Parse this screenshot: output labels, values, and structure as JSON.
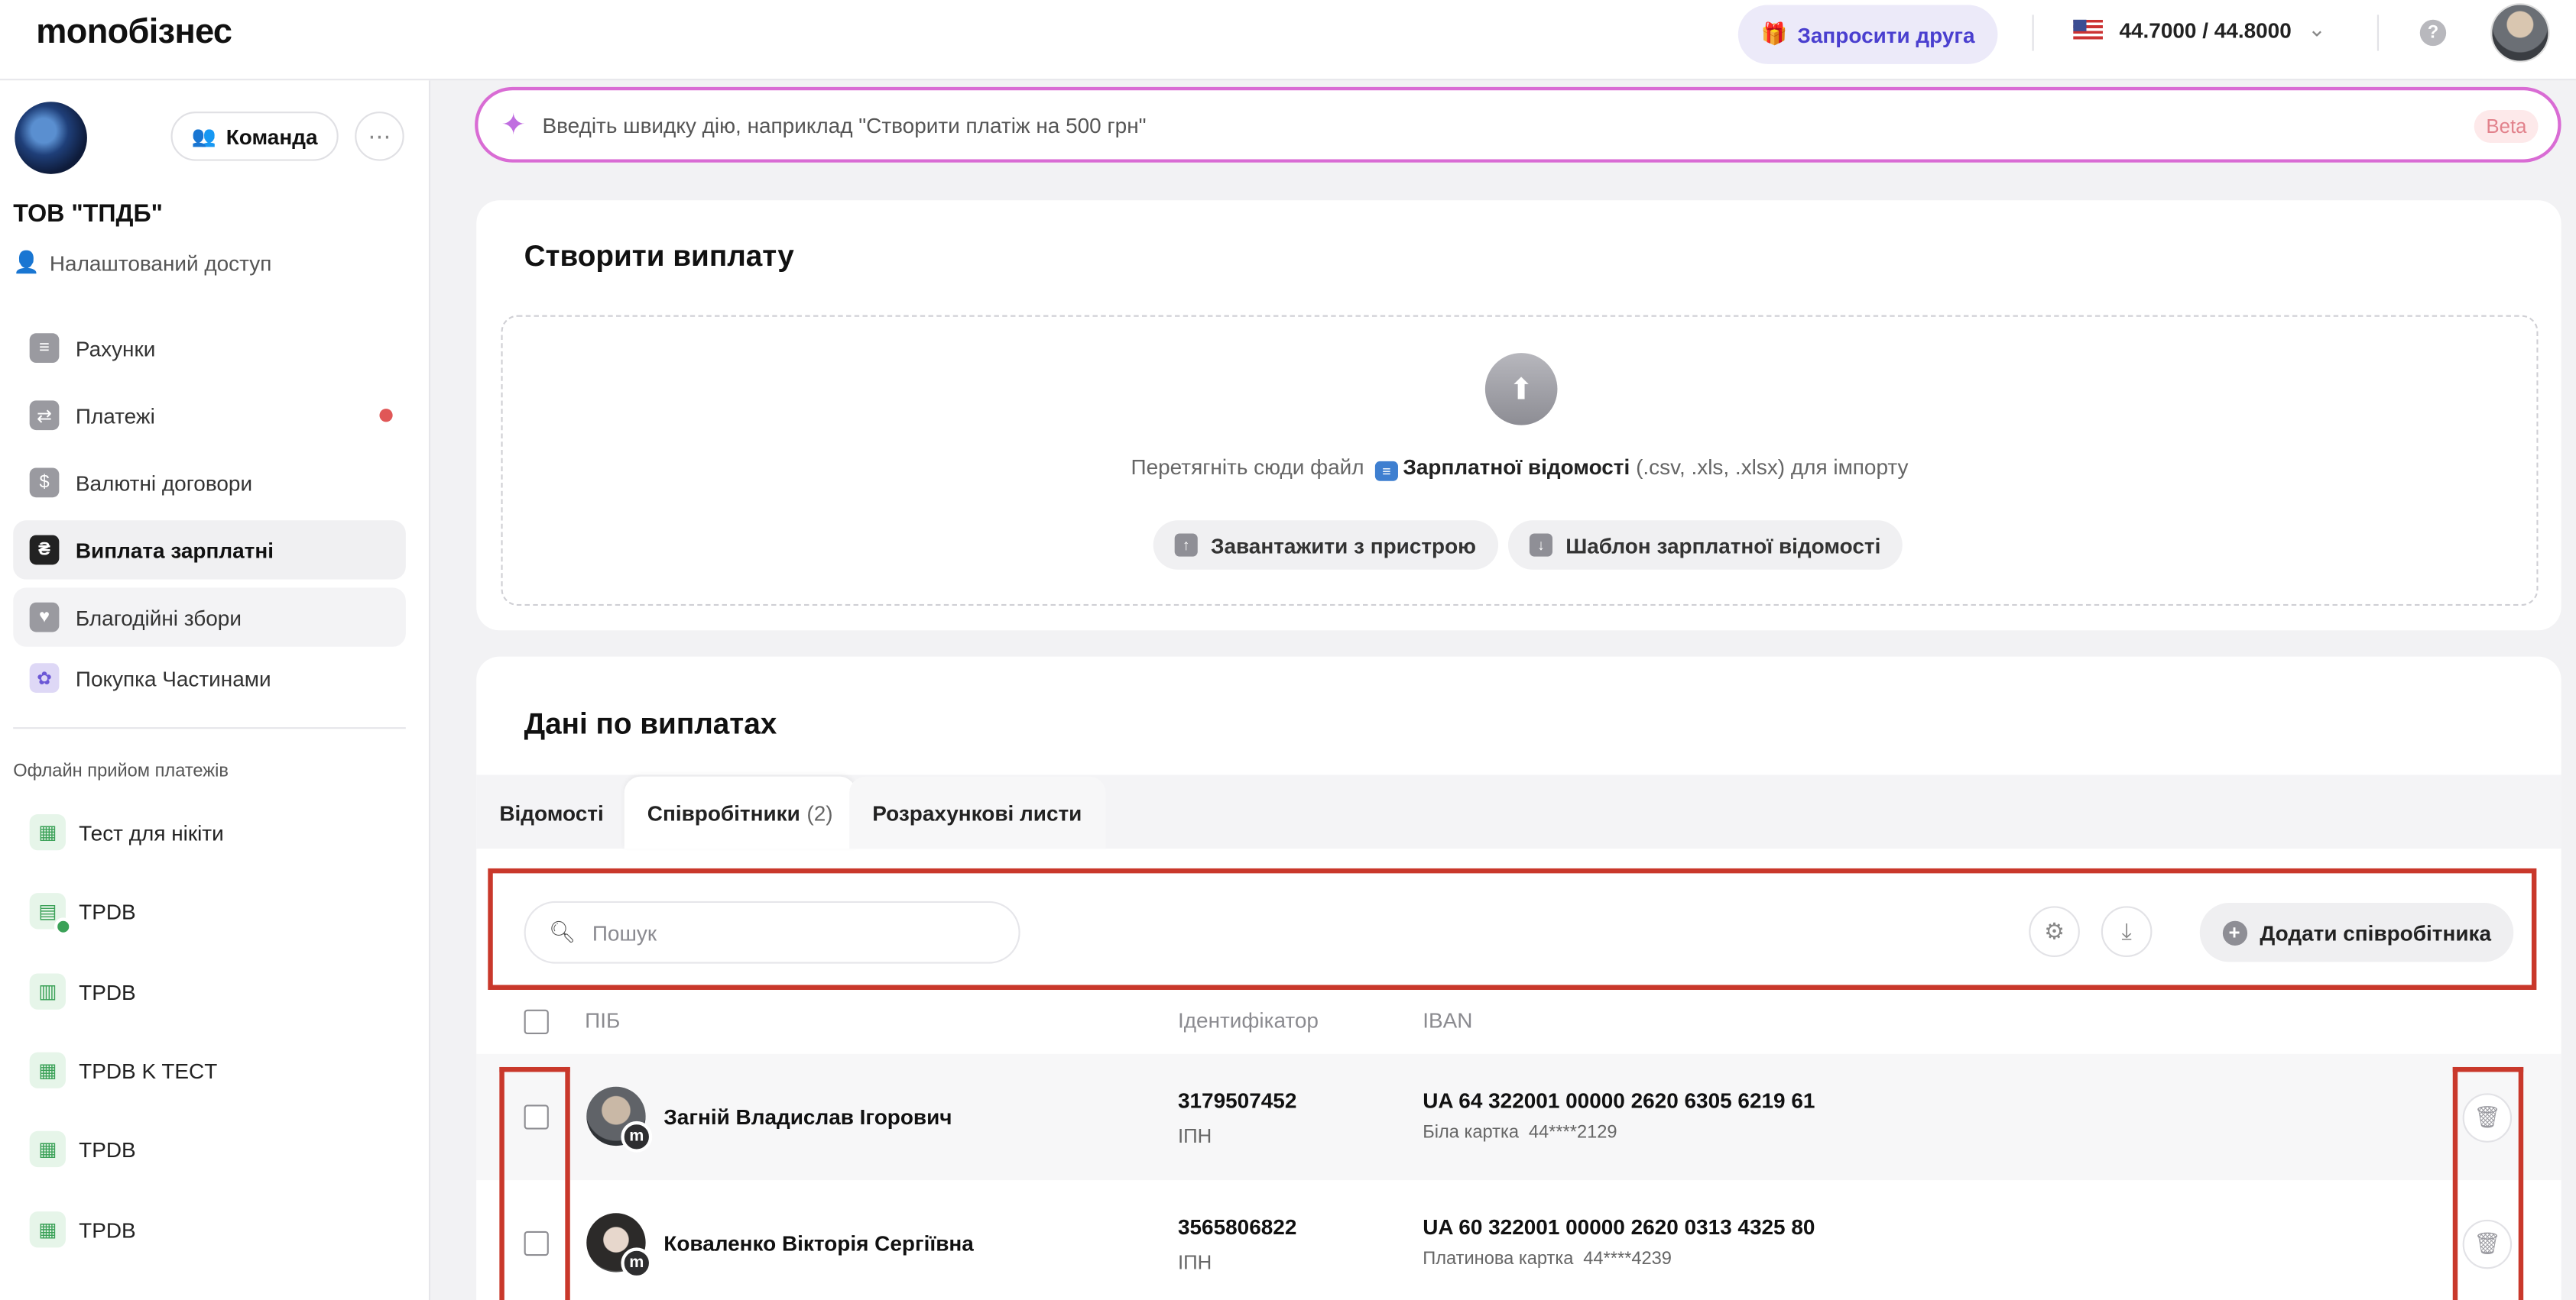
{
  "app": {
    "logo": "monoбізнес",
    "invite_label": "Запросити друга",
    "rate": "44.7000 / 44.8000"
  },
  "sidebar": {
    "team_label": "Команда",
    "org_name": "ТОВ \"ТПДБ\"",
    "access_label": "Налаштований доступ",
    "nav": [
      {
        "label": "Рахунки"
      },
      {
        "label": "Платежі"
      },
      {
        "label": "Валютні договори"
      },
      {
        "label": "Виплата зарплатні"
      },
      {
        "label": "Благодійні збори"
      },
      {
        "label": "Покупка Частинами"
      }
    ],
    "section_title": "Офлайн прийом платежів",
    "terminals": [
      {
        "label": "Тест для нікіти"
      },
      {
        "label": "TPDB"
      },
      {
        "label": "TPDB"
      },
      {
        "label": "TPDB K TECT"
      },
      {
        "label": "TPDB"
      },
      {
        "label": "TPDB"
      }
    ]
  },
  "quick_action": {
    "placeholder": "Введіть швидку дію, наприклад \"Створити платіж на 500 грн\"",
    "beta": "Beta"
  },
  "create": {
    "title": "Створити виплату",
    "drop_prefix": "Перетягніть сюди файл",
    "drop_bold": "Зарплатної відомості",
    "drop_suffix": "(.csv, .xls, .xlsx) для імпорту",
    "upload_label": "Завантажити з пристрою",
    "template_label": "Шаблон зарплатної відомості"
  },
  "data": {
    "title": "Дані по виплатах",
    "tabs": [
      {
        "label": "Відомості"
      },
      {
        "label": "Співробітники",
        "count": "(2)"
      },
      {
        "label": "Розрахункові листи"
      }
    ],
    "search_placeholder": "Пошук",
    "add_label": "Додати співробітника",
    "columns": {
      "name": "ПІБ",
      "id": "Ідентифікатор",
      "iban": "IBAN"
    },
    "employees": [
      {
        "name": "Загній Владислав Ігорович",
        "id": "3179507452",
        "id_label": "ІПН",
        "iban": "UA 64 322001 00000 2620 6305 6219 61",
        "card_type": "Біла картка",
        "card_mask": "44****2129",
        "badge": "m"
      },
      {
        "name": "Коваленко Вікторія Сергіївна",
        "id": "3565806822",
        "id_label": "ІПН",
        "iban": "UA 60 322001 00000 2620 0313 4325 80",
        "card_type": "Платинова картка",
        "card_mask": "44****4239",
        "badge": "m"
      }
    ]
  },
  "colors": {
    "accent": "#4a3fcf",
    "highlight": "#c9382b",
    "quick_border": "#d96cd4"
  }
}
